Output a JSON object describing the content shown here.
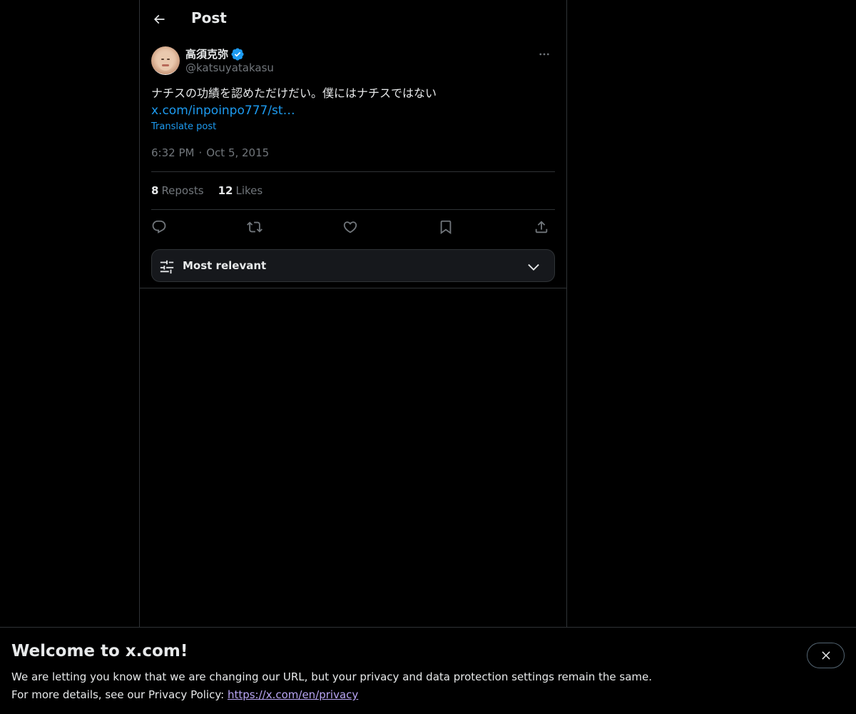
{
  "header": {
    "title": "Post"
  },
  "post": {
    "display_name": "高須克弥",
    "handle": "@katsuyatakasu",
    "text": "ナチスの功績を認めただけだい。僕にはナチスではない",
    "link": "x.com/inpoinpo777/st…",
    "translate_label": "Translate post",
    "time": "6:32 PM",
    "date": "Oct 5, 2015",
    "reposts_count": "8",
    "reposts_label": "Reposts",
    "likes_count": "12",
    "likes_label": "Likes"
  },
  "sort": {
    "label": "Most relevant"
  },
  "banner": {
    "title": "Welcome to x.com!",
    "line1": "We are letting you know that we are changing our URL, but your privacy and data protection settings remain the same.",
    "line2_prefix": "For more details, see our Privacy Policy: ",
    "privacy_link": "https://x.com/en/privacy"
  },
  "colors": {
    "background": "#000000",
    "accent": "#1d9bf0",
    "border": "#2f3336",
    "muted_text": "#71767b",
    "verified": "#1d9bf0"
  },
  "icons": [
    "back-arrow-icon",
    "verified-badge-icon",
    "more-icon",
    "reply-icon",
    "repost-icon",
    "like-icon",
    "bookmark-icon",
    "share-icon",
    "sort-sliders-icon",
    "chevron-down-icon",
    "close-icon"
  ]
}
